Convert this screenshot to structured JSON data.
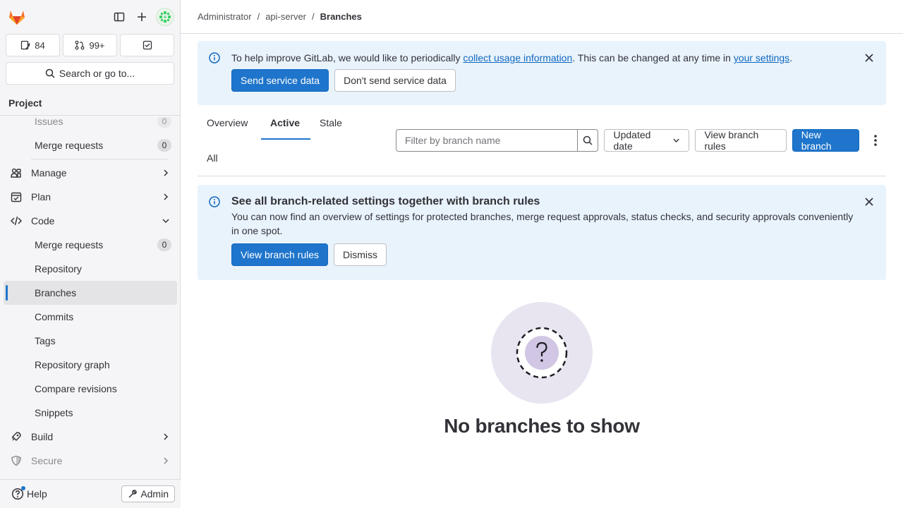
{
  "sidebar": {
    "counts": {
      "issues": "84",
      "merge_requests": "99+"
    },
    "search_label": "Search or go to...",
    "section_title": "Project",
    "items": [
      {
        "label": "Issues",
        "badge": "0"
      },
      {
        "label": "Merge requests",
        "badge": "0"
      },
      {
        "label": "Manage"
      },
      {
        "label": "Plan"
      },
      {
        "label": "Code"
      },
      {
        "label": "Merge requests",
        "badge": "0"
      },
      {
        "label": "Repository"
      },
      {
        "label": "Branches"
      },
      {
        "label": "Commits"
      },
      {
        "label": "Tags"
      },
      {
        "label": "Repository graph"
      },
      {
        "label": "Compare revisions"
      },
      {
        "label": "Snippets"
      },
      {
        "label": "Build"
      },
      {
        "label": "Secure"
      }
    ],
    "help_label": "Help",
    "admin_label": "Admin"
  },
  "breadcrumb": {
    "items": [
      "Administrator",
      "api-server",
      "Branches"
    ],
    "sep": "/"
  },
  "usage_alert": {
    "text_before": "To help improve GitLab, we would like to periodically ",
    "link1": "collect usage information",
    "text_mid": ". This can be changed at any time in ",
    "link2": "your settings",
    "text_after": ".",
    "send_label": "Send service data",
    "dont_send_label": "Don't send service data"
  },
  "tabs": [
    "Overview",
    "Active",
    "Stale",
    "All"
  ],
  "filter": {
    "placeholder": "Filter by branch name",
    "sort_label": "Updated date",
    "view_rules_label": "View branch rules",
    "new_branch_label": "New branch"
  },
  "rules_alert": {
    "title": "See all branch-related settings together with branch rules",
    "body": "You can now find an overview of settings for protected branches, merge request approvals, status checks, and security approvals conveniently in one spot.",
    "view_label": "View branch rules",
    "dismiss_label": "Dismiss"
  },
  "empty_state": {
    "title": "No branches to show"
  },
  "colors": {
    "accent": "#1f75cb",
    "alert_bg": "#e9f3fc",
    "empty_circle": "#e8e5f1",
    "empty_inner": "#d1c6e3"
  }
}
